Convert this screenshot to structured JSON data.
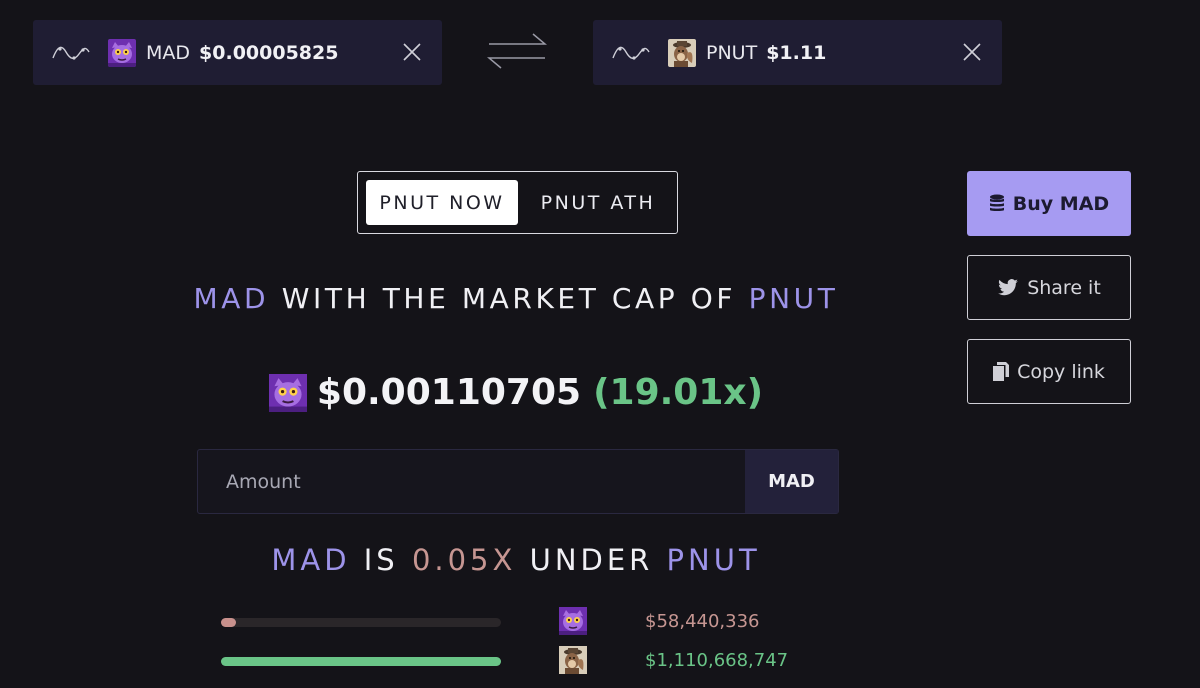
{
  "token_a": {
    "symbol": "MAD",
    "price": "$0.00005825",
    "icon": "mad-cat-avatar"
  },
  "token_b": {
    "symbol": "PNUT",
    "price": "$1.11",
    "icon": "pnut-squirrel-avatar"
  },
  "toggle": {
    "active": "PNUT NOW",
    "inactive": "PNUT ATH"
  },
  "actions": {
    "buy": "Buy MAD",
    "share": "Share it",
    "copy": "Copy link"
  },
  "headline": {
    "token_a": "MAD",
    "middle": "WITH THE MARKET CAP OF",
    "token_b": "PNUT"
  },
  "result": {
    "price": "$0.00110705",
    "multiplier": "(19.01x)"
  },
  "amount": {
    "placeholder": "Amount",
    "unit": "MAD"
  },
  "comparison": {
    "token_a": "MAD",
    "is": "IS",
    "factor": "0.05X",
    "under": "UNDER",
    "token_b": "PNUT"
  },
  "market_caps": [
    {
      "token": "MAD",
      "value": "$58,440,336",
      "fill_fraction": 0.0526
    },
    {
      "token": "PNUT",
      "value": "$1,110,668,747",
      "fill_fraction": 1.0
    }
  ],
  "colors": {
    "accent": "#9d93e9",
    "positive": "#6ac487",
    "negative": "#c69692",
    "buy_button": "#a69bf2"
  }
}
